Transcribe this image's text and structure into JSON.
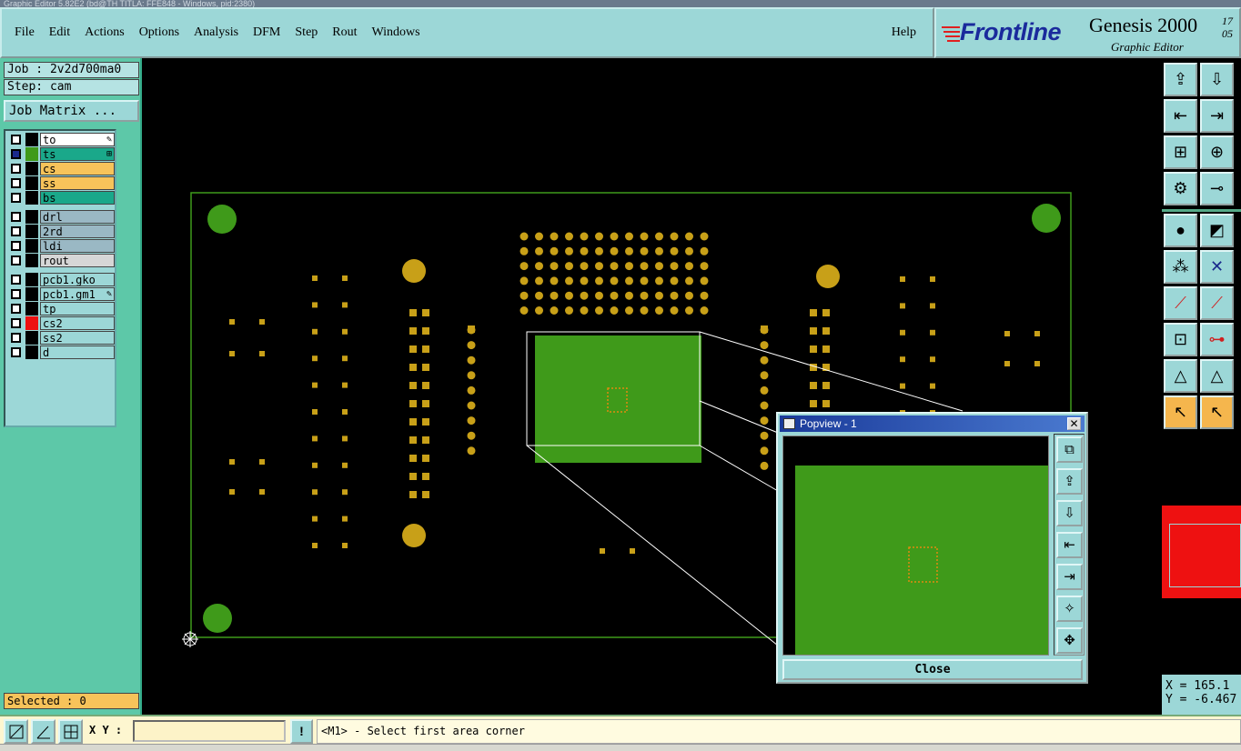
{
  "window": {
    "title": "Graphic Editor 5.82E2 (bd@TH TITLA: FFE848 - Windows, pid:2380)"
  },
  "menu": {
    "items": [
      "File",
      "Edit",
      "Actions",
      "Options",
      "Analysis",
      "DFM",
      "Step",
      "Rout",
      "Windows"
    ],
    "help": "Help"
  },
  "brand": {
    "company": "Frontline",
    "product": "Genesis 2000",
    "subtitle": "Graphic Editor",
    "version_top": "17",
    "version_bottom": "05"
  },
  "job": {
    "label": "Job : 2v2d700ma0",
    "step": "Step: cam",
    "matrix_button": "Job Matrix ..."
  },
  "layers": [
    {
      "name": "to",
      "color": "#ffffff",
      "swatch": "#000000",
      "checked": false,
      "mark": "✎"
    },
    {
      "name": "ts",
      "color": "#1aa88a",
      "swatch": "#3f9a1a",
      "checked": true,
      "mark": "⊞"
    },
    {
      "name": "cs",
      "color": "#f7c35a",
      "swatch": "#000000",
      "checked": false,
      "mark": ""
    },
    {
      "name": "ss",
      "color": "#f7c35a",
      "swatch": "#000000",
      "checked": false,
      "mark": ""
    },
    {
      "name": "bs",
      "color": "#1aa88a",
      "swatch": "#000000",
      "checked": false,
      "mark": ""
    },
    {
      "name": "drl",
      "color": "#9ab8c4",
      "swatch": "#000000",
      "checked": false,
      "mark": ""
    },
    {
      "name": "2rd",
      "color": "#9ab8c4",
      "swatch": "#000000",
      "checked": false,
      "mark": ""
    },
    {
      "name": "ldi",
      "color": "#9ab8c4",
      "swatch": "#000000",
      "checked": false,
      "mark": ""
    },
    {
      "name": "rout",
      "color": "#d6d6d6",
      "swatch": "#000000",
      "checked": false,
      "mark": ""
    },
    {
      "name": "pcb1.gko",
      "color": "#9cd7d7",
      "swatch": "#000000",
      "checked": false,
      "mark": ""
    },
    {
      "name": "pcb1.gm1",
      "color": "#9cd7d7",
      "swatch": "#000000",
      "checked": false,
      "mark": "✎"
    },
    {
      "name": "tp",
      "color": "#9cd7d7",
      "swatch": "#000000",
      "checked": false,
      "mark": ""
    },
    {
      "name": "cs2",
      "color": "#9cd7d7",
      "swatch": "#ee1111",
      "checked": false,
      "mark": ""
    },
    {
      "name": "ss2",
      "color": "#9cd7d7",
      "swatch": "#000000",
      "checked": false,
      "mark": ""
    },
    {
      "name": "d",
      "color": "#9cd7d7",
      "swatch": "#000000",
      "checked": false,
      "mark": ""
    }
  ],
  "selected": "Selected : 0",
  "coords": {
    "x": "X = 165.1",
    "y": "Y = -6.467"
  },
  "status": {
    "xy_label": "X Y :",
    "xy_value": "",
    "prompt": "<M1> - Select first area corner",
    "warn": "!"
  },
  "popview": {
    "title": "Popview - 1",
    "close": "Close"
  },
  "colors": {
    "board_outline": "#3f9a1a",
    "pad": "#c8a018",
    "copper_fill": "#3f9a1a",
    "accent": "#9cd7d7"
  },
  "icons": {
    "tools": [
      "zoom-home-icon",
      "zoom-fit-icon",
      "pan-left-icon",
      "pan-right-icon",
      "zoom-in-icon",
      "zoom-out-icon",
      "measure-icon",
      "snap-icon",
      "select-feature-icon",
      "edit-feature-icon",
      "netlist-icon",
      "cross-icon",
      "line-icon",
      "line-select-icon",
      "pad-icon",
      "split-icon",
      "triangle-icon",
      "triangle-select-icon",
      "pointer-icon",
      "pointer-select-icon"
    ]
  }
}
